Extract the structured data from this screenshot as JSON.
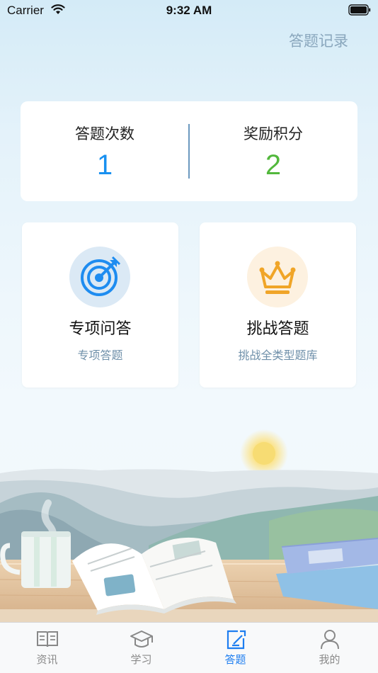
{
  "status_bar": {
    "carrier": "Carrier",
    "time": "9:32 AM"
  },
  "header": {
    "record_link": "答题记录"
  },
  "stats": {
    "count_label": "答题次数",
    "count_value": "1",
    "points_label": "奖励积分",
    "points_value": "2"
  },
  "modes": [
    {
      "title": "专项问答",
      "subtitle": "专项答题",
      "icon": "target-icon"
    },
    {
      "title": "挑战答题",
      "subtitle": "挑战全类型题库",
      "icon": "crown-icon"
    }
  ],
  "tabs": [
    {
      "label": "资讯",
      "icon": "book-icon"
    },
    {
      "label": "学习",
      "icon": "graduation-cap-icon"
    },
    {
      "label": "答题",
      "icon": "edit-icon",
      "active": true
    },
    {
      "label": "我的",
      "icon": "user-icon"
    }
  ],
  "colors": {
    "accent": "#1e7ef0",
    "count_value": "#1890f0",
    "points_value": "#52b83c",
    "crown": "#f0a528"
  }
}
